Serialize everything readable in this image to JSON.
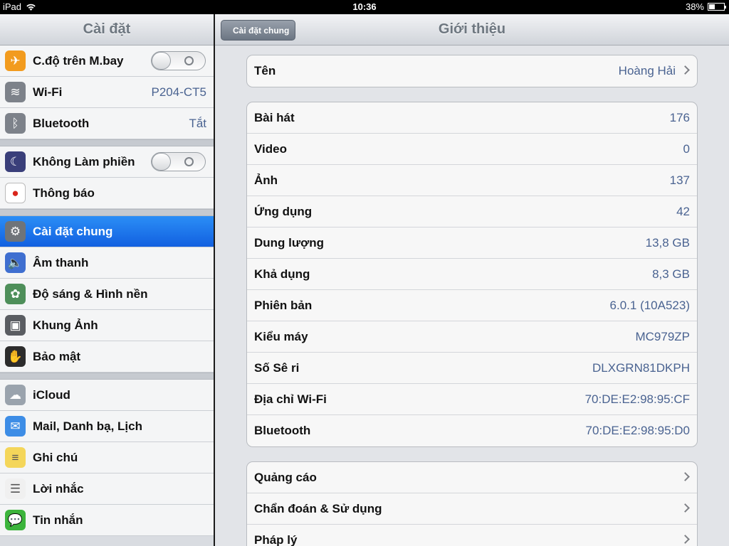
{
  "status": {
    "device": "iPad",
    "time": "10:36",
    "battery": "38%",
    "battery_level": 0.38
  },
  "master": {
    "title": "Cài đặt",
    "groups": [
      [
        {
          "label": "C.độ trên M.bay",
          "icon": "airplane-icon",
          "icon_color": "#f29b1e",
          "control": "toggle"
        },
        {
          "label": "Wi-Fi",
          "icon": "wifi-icon",
          "icon_color": "#7d828a",
          "value": "P204-CT5"
        },
        {
          "label": "Bluetooth",
          "icon": "bluetooth-icon",
          "icon_color": "#7d828a",
          "value": "Tắt"
        }
      ],
      [
        {
          "label": "Không Làm phiền",
          "icon": "moon-icon",
          "icon_color": "#3a3f7a",
          "control": "toggle"
        },
        {
          "label": "Thông báo",
          "icon": "notification-icon",
          "icon_color": "#d9261c"
        }
      ],
      [
        {
          "label": "Cài đặt chung",
          "icon": "gear-icon",
          "icon_color": "#6f7479",
          "selected": true
        },
        {
          "label": "Âm thanh",
          "icon": "speaker-icon",
          "icon_color": "#3f6fd0"
        },
        {
          "label": "Độ sáng & Hình nền",
          "icon": "flower-icon",
          "icon_color": "#4e8f5a"
        },
        {
          "label": "Khung Ảnh",
          "icon": "picture-frame-icon",
          "icon_color": "#5a5d62"
        },
        {
          "label": "Bảo mật",
          "icon": "hand-icon",
          "icon_color": "#2c2c2c"
        }
      ],
      [
        {
          "label": "iCloud",
          "icon": "cloud-icon",
          "icon_color": "#9aa3ad"
        },
        {
          "label": "Mail, Danh bạ, Lịch",
          "icon": "mail-icon",
          "icon_color": "#3d8de6"
        },
        {
          "label": "Ghi chú",
          "icon": "notes-icon",
          "icon_color": "#f4d65a"
        },
        {
          "label": "Lời nhắc",
          "icon": "reminders-icon",
          "icon_color": "#f0f0f0"
        },
        {
          "label": "Tin nhắn",
          "icon": "messages-icon",
          "icon_color": "#3cb43c"
        }
      ]
    ]
  },
  "detail": {
    "back_label": "Cài đặt chung",
    "title": "Giới thiệu",
    "name_row": {
      "label": "Tên",
      "value": "Hoàng Hải"
    },
    "info": [
      {
        "label": "Bài hát",
        "value": "176"
      },
      {
        "label": "Video",
        "value": "0"
      },
      {
        "label": "Ảnh",
        "value": "137"
      },
      {
        "label": "Ứng dụng",
        "value": "42"
      },
      {
        "label": "Dung lượng",
        "value": "13,8 GB"
      },
      {
        "label": "Khả dụng",
        "value": "8,3 GB"
      },
      {
        "label": "Phiên bản",
        "value": "6.0.1 (10A523)"
      },
      {
        "label": "Kiểu máy",
        "value": "MC979ZP"
      },
      {
        "label": "Số Sê ri",
        "value": "DLXGRN81DKPH"
      },
      {
        "label": "Địa chỉ Wi-Fi",
        "value": "70:DE:E2:98:95:CF"
      },
      {
        "label": "Bluetooth",
        "value": "70:DE:E2:98:95:D0"
      }
    ],
    "links": [
      {
        "label": "Quảng cáo"
      },
      {
        "label": "Chẩn đoán & Sử dụng"
      },
      {
        "label": "Pháp lý"
      }
    ]
  }
}
